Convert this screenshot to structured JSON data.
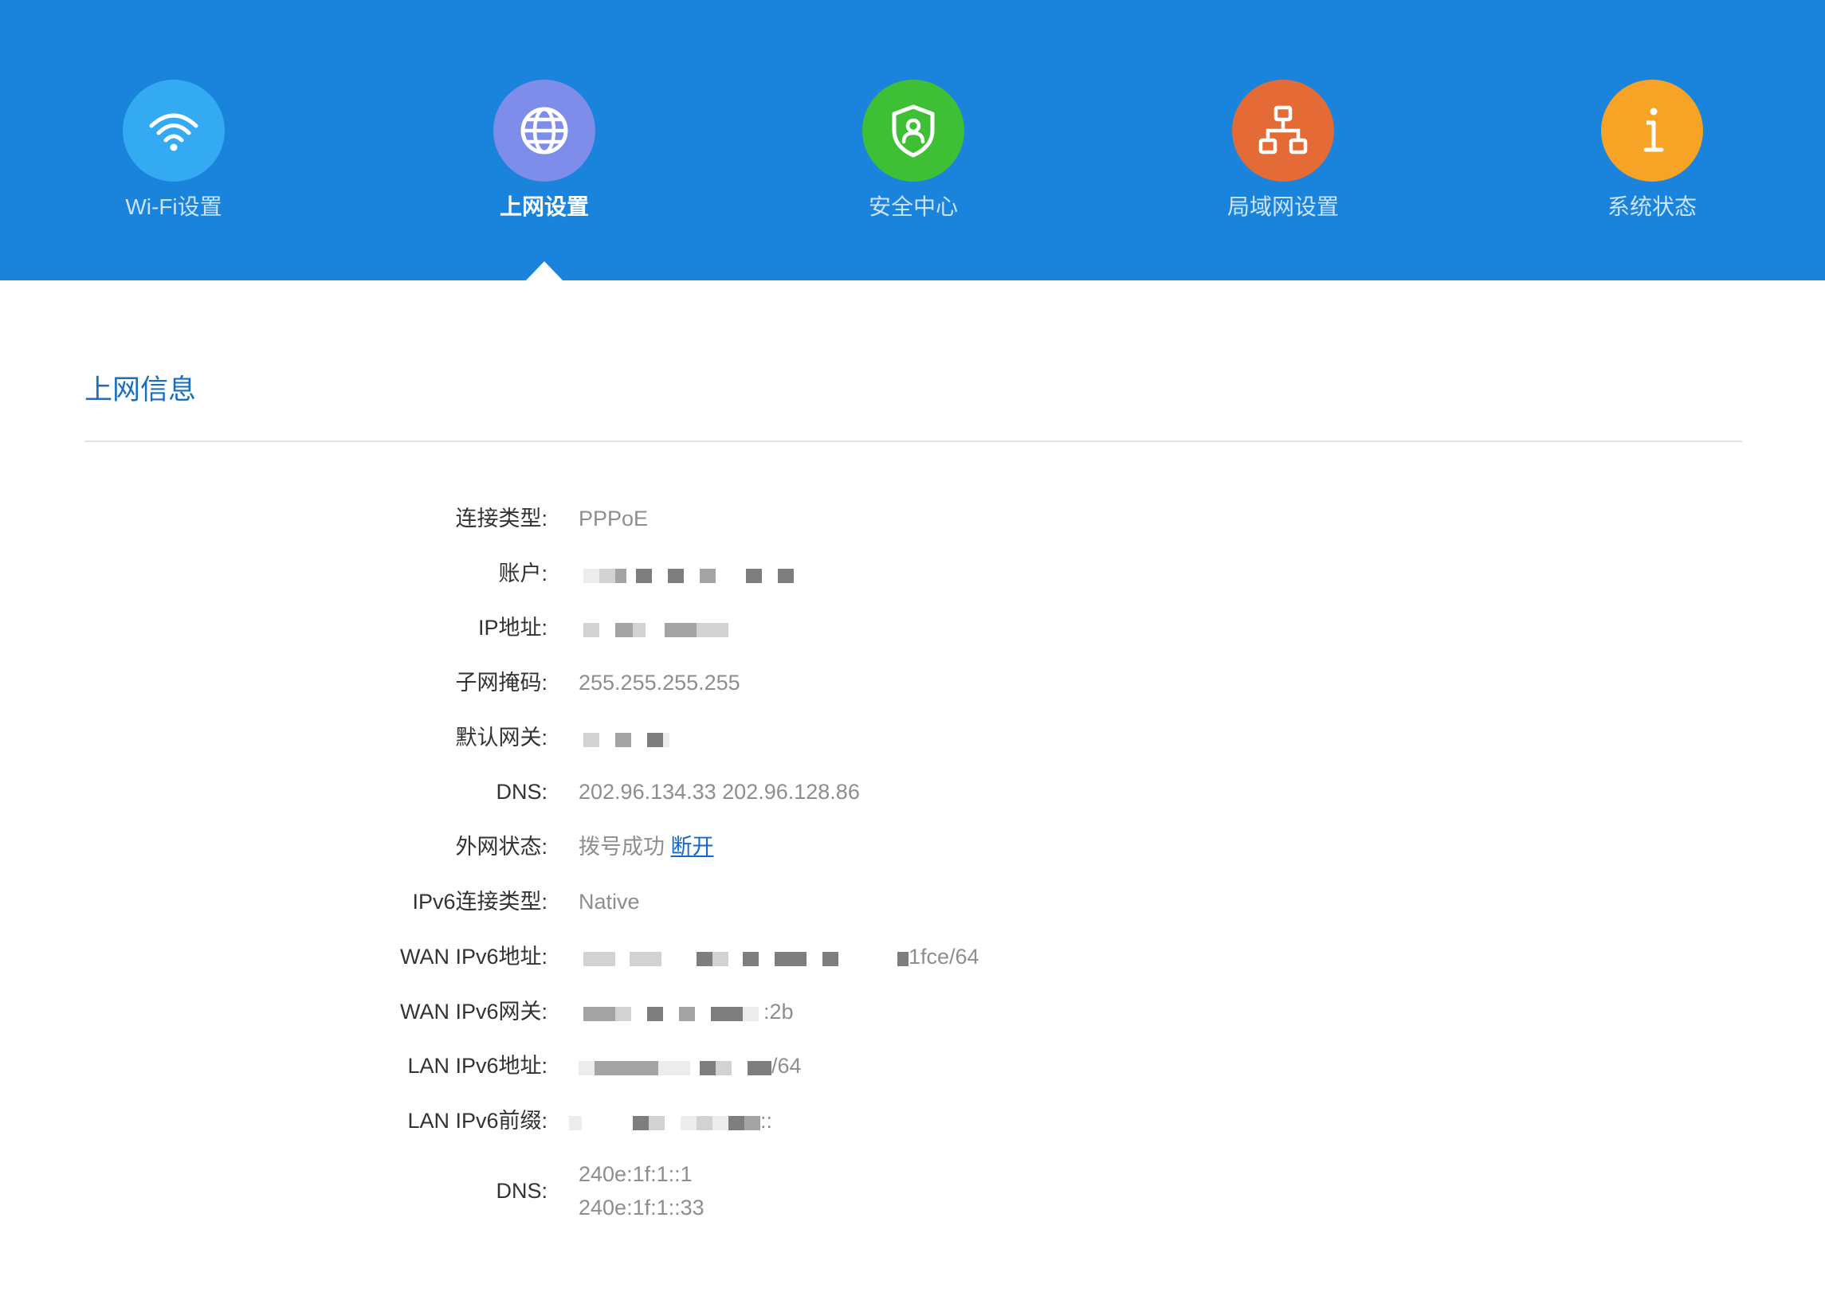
{
  "nav": {
    "items": [
      {
        "label": "Wi-Fi设置",
        "icon": "wifi-icon",
        "color": "#33aaf2"
      },
      {
        "label": "上网设置",
        "icon": "globe-icon",
        "color": "#7e8cea"
      },
      {
        "label": "安全中心",
        "icon": "shield-user-icon",
        "color": "#3fbf36"
      },
      {
        "label": "局域网设置",
        "icon": "network-topology-icon",
        "color": "#e46a36"
      },
      {
        "label": "系统状态",
        "icon": "info-icon",
        "color": "#f7a326"
      }
    ],
    "active_index": 1,
    "background": "#1a84dd"
  },
  "section": {
    "title": "上网信息"
  },
  "info": {
    "connection_type": {
      "label": "连接类型:",
      "value": "PPPoE"
    },
    "account": {
      "label": "账户:"
    },
    "ip_address": {
      "label": "IP地址:"
    },
    "subnet_mask": {
      "label": "子网掩码:",
      "value": "255.255.255.255"
    },
    "default_gateway": {
      "label": "默认网关:"
    },
    "dns": {
      "label": "DNS:",
      "value": "202.96.134.33 202.96.128.86"
    },
    "wan_status": {
      "label": "外网状态:",
      "value": "拨号成功",
      "action": "断开"
    },
    "ipv6_connection_type": {
      "label": "IPv6连接类型:",
      "value": "Native"
    },
    "wan_ipv6_address": {
      "label": "WAN IPv6地址:",
      "value_suffix": "1fce/64"
    },
    "wan_ipv6_gateway": {
      "label": "WAN IPv6网关:",
      "value_suffix": ":2b"
    },
    "lan_ipv6_address": {
      "label": "LAN IPv6地址:",
      "value_suffix": "/64"
    },
    "lan_ipv6_prefix": {
      "label": "LAN IPv6前缀:",
      "value_suffix": "::"
    },
    "dns6": {
      "label": "DNS:",
      "values": [
        "240e:1f:1::1",
        "240e:1f:1::33"
      ]
    }
  },
  "colors": {
    "title": "#1a6fbd",
    "label": "#333333",
    "value": "#8e8e8e",
    "link": "#1468c8"
  }
}
